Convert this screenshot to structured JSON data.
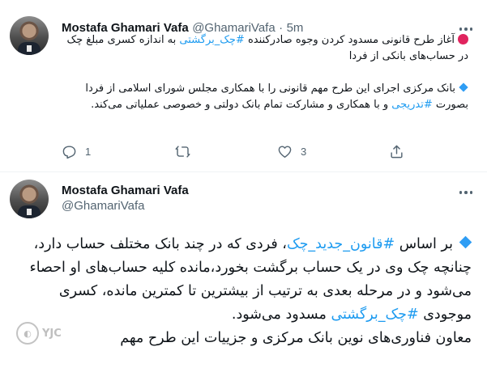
{
  "tweet1": {
    "author_name": "Mostafa Ghamari Vafa",
    "handle": "@GhamariVafa",
    "separator": "·",
    "time": "5m",
    "paragraph1_before": "آغاز طرح قانونی مسدود کردن وجوه صادرکننده ",
    "paragraph1_hashtag": "#چک_برگشتی",
    "paragraph1_after": " به اندازه کسری مبلغ چک در حساب‌های بانکی از فردا",
    "paragraph2_before": "بانک مرکزی اجرای این طرح مهم قانونی را با همکاری مجلس شورای اسلامی از فردا بصورت ",
    "paragraph2_hashtag": "#تدریجی",
    "paragraph2_after": " و با همکاری و مشارکت تمام بانک دولتی و خصوصی عملیاتی می‌کند.",
    "reply_count": "1",
    "like_count": "3"
  },
  "tweet2": {
    "author_name": "Mostafa Ghamari Vafa",
    "handle": "@GhamariVafa",
    "text_part1": "بر اساس ",
    "hashtag1": "#قانون_جدید_چک",
    "text_part2": "، فردی که در چند بانک مختلف حساب دارد، چنانچه چک وی در یک حساب برگشت بخورد،مانده کلیه حساب‌های او احصاء می‌شود و در مرحله بعدی به ترتیب از بیشترین تا کمترین مانده، کسری موجودی ",
    "hashtag2": "#چک_برگشتی",
    "text_part3": " مسدود می‌شود.",
    "text_part4": "معاون فناوری‌های نوین بانک مرکزی و جزییات این طرح مهم"
  },
  "watermark": {
    "text": "YJC"
  },
  "colors": {
    "hashtag": "#1d9bf0",
    "muted": "#536471",
    "red_dot": "#e0245e",
    "diamond": "#2f9df4"
  }
}
